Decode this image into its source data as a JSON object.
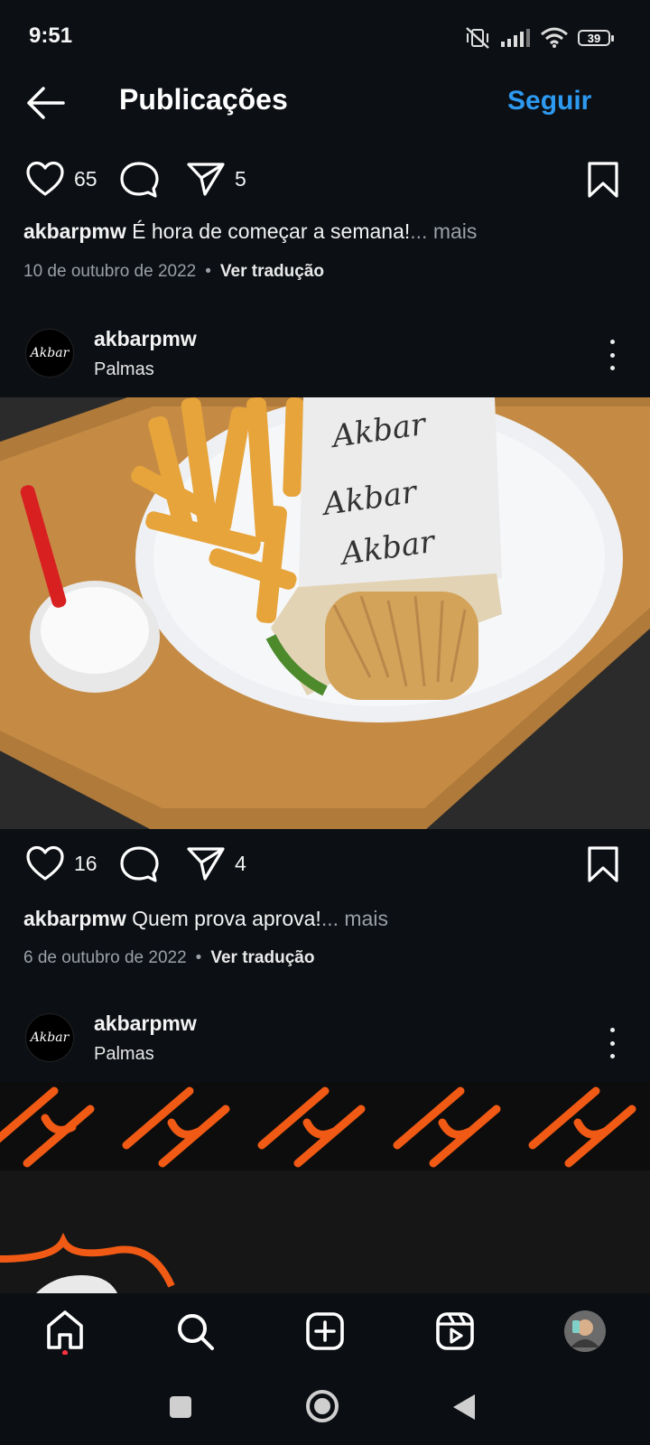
{
  "status_bar": {
    "time": "9:51",
    "battery": "39"
  },
  "header": {
    "title": "Publicações",
    "follow_label": "Seguir"
  },
  "posts": [
    {
      "likes": "65",
      "shares": "5",
      "caption_user": "akbarpmw",
      "caption_text": " É hora de começar a semana!",
      "more": "... mais",
      "date": "10 de outubro de 2022",
      "translate": "Ver tradução"
    },
    {
      "username": "akbarpmw",
      "location": "Palmas",
      "avatar_text": "Akbar",
      "likes": "16",
      "shares": "4",
      "caption_user": "akbarpmw",
      "caption_text": " Quem prova aprova!",
      "more": "... mais",
      "date": "6 de outubro de 2022",
      "translate": "Ver tradução",
      "image_description": "Wrap with fries and sauce on a wooden tray"
    },
    {
      "username": "akbarpmw",
      "location": "Palmas",
      "avatar_text": "Akbar"
    }
  ],
  "nav": [
    "home-icon",
    "search-icon",
    "create-icon",
    "reels-icon",
    "profile-avatar"
  ],
  "colors": {
    "background": "#0c0f14",
    "accent": "#2d9af0",
    "brand_orange": "#f05a14"
  }
}
